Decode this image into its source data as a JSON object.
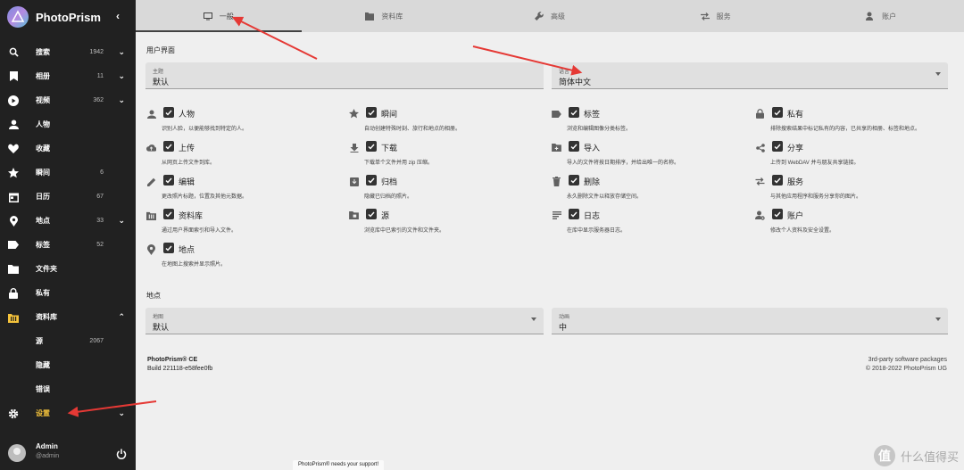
{
  "app": {
    "name": "PhotoPrism",
    "collapse": "‹"
  },
  "sidebar": {
    "items": [
      {
        "key": "search",
        "label": "搜索",
        "count": "1942",
        "chev": true,
        "icon": "search-icon"
      },
      {
        "key": "albums",
        "label": "相册",
        "count": "11",
        "chev": true,
        "icon": "bookmark-icon"
      },
      {
        "key": "videos",
        "label": "视频",
        "count": "362",
        "chev": true,
        "icon": "play-icon"
      },
      {
        "key": "people",
        "label": "人物",
        "count": "",
        "chev": false,
        "icon": "person-icon"
      },
      {
        "key": "favorites",
        "label": "收藏",
        "count": "",
        "chev": false,
        "icon": "heart-icon"
      },
      {
        "key": "moments",
        "label": "瞬间",
        "count": "6",
        "chev": false,
        "icon": "star-icon"
      },
      {
        "key": "calendar",
        "label": "日历",
        "count": "67",
        "chev": false,
        "icon": "calendar-icon"
      },
      {
        "key": "places",
        "label": "地点",
        "count": "33",
        "chev": true,
        "icon": "location-icon"
      },
      {
        "key": "labels",
        "label": "标签",
        "count": "52",
        "chev": false,
        "icon": "label-icon"
      },
      {
        "key": "folders",
        "label": "文件夹",
        "count": "",
        "chev": false,
        "icon": "folder-icon"
      },
      {
        "key": "private",
        "label": "私有",
        "count": "",
        "chev": false,
        "icon": "lock-icon"
      },
      {
        "key": "library",
        "label": "资料库",
        "count": "",
        "chev": true,
        "icon": "library-icon"
      },
      {
        "key": "originals",
        "label": "源",
        "count": "2067",
        "chev": false,
        "icon": ""
      },
      {
        "key": "hidden",
        "label": "隐藏",
        "count": "",
        "chev": false,
        "icon": ""
      },
      {
        "key": "errors",
        "label": "错误",
        "count": "",
        "chev": false,
        "icon": ""
      },
      {
        "key": "settings",
        "label": "设置",
        "count": "",
        "chev": true,
        "icon": "gear-icon"
      }
    ],
    "user": {
      "name": "Admin",
      "handle": "@admin"
    }
  },
  "tabs": [
    {
      "label": "一般",
      "icon": "monitor-icon"
    },
    {
      "label": "资料库",
      "icon": "library-icon"
    },
    {
      "label": "高级",
      "icon": "wrench-icon"
    },
    {
      "label": "服务",
      "icon": "swap-icon"
    },
    {
      "label": "账户",
      "icon": "account-icon"
    }
  ],
  "ui_section": {
    "title": "用户界面",
    "theme": {
      "label": "主题",
      "value": "默认"
    },
    "language": {
      "label": "语言",
      "value": "简体中文"
    }
  },
  "features": [
    {
      "name": "人物",
      "desc": "识别人脸，以便能够找到特定的人。",
      "icon": "person-icon"
    },
    {
      "name": "瞬间",
      "desc": "自动创建特殊时刻、旅行和地点的相册。",
      "icon": "star-icon"
    },
    {
      "name": "标签",
      "desc": "浏览和编辑图像分类标签。",
      "icon": "label-icon"
    },
    {
      "name": "私有",
      "desc": "排除搜索结果中标记私有的内容，已共享的相册、标签和地点。",
      "icon": "lock-icon"
    },
    {
      "name": "上传",
      "desc": "从网页上传文件到库。",
      "icon": "cloud-upload-icon"
    },
    {
      "name": "下载",
      "desc": "下载单个文件并用 zip 压缩。",
      "icon": "download-icon"
    },
    {
      "name": "导入",
      "desc": "导入的文件将按日期排序，并给出唯一的名称。",
      "icon": "import-icon"
    },
    {
      "name": "分享",
      "desc": "上传到 WebDAV 并与朋友共享链接。",
      "icon": "share-icon"
    },
    {
      "name": "编辑",
      "desc": "更改照片标题，位置及其他元数据。",
      "icon": "pencil-icon"
    },
    {
      "name": "归档",
      "desc": "隐藏已归档的照片。",
      "icon": "archive-icon"
    },
    {
      "name": "删除",
      "desc": "永久删除文件以释放存储空间。",
      "icon": "trash-icon"
    },
    {
      "name": "服务",
      "desc": "与其他应用程序和服务分享你的图片。",
      "icon": "swap-icon"
    },
    {
      "name": "资料库",
      "desc": "通过用户界面索引和导入文件。",
      "icon": "library-icon"
    },
    {
      "name": "源",
      "desc": "浏览库中已索引的文件和文件夹。",
      "icon": "folder-image-icon"
    },
    {
      "name": "日志",
      "desc": "在库中显示服务器日志。",
      "icon": "log-icon"
    },
    {
      "name": "账户",
      "desc": "修改个人资料及安全设置。",
      "icon": "account-settings-icon"
    },
    {
      "name": "地点",
      "desc": "在地图上搜索并显示照片。",
      "icon": "location-icon"
    }
  ],
  "places_section": {
    "title": "地点",
    "map": {
      "label": "地图",
      "value": "默认"
    },
    "animation": {
      "label": "动画",
      "value": "中"
    }
  },
  "footer": {
    "product": "PhotoPrism® CE",
    "build": "Build 221118-e58fee0fb",
    "packages": "3rd-party software packages",
    "copyright": "© 2018-2022 PhotoPrism UG"
  },
  "support_banner": "PhotoPrism® needs your support!",
  "watermark": {
    "glyph": "值",
    "text": "什么值得买"
  },
  "colors": {
    "sidebar_bg": "#212121",
    "active_label": "#f5c33b",
    "annotation_arrow": "#e53935"
  }
}
